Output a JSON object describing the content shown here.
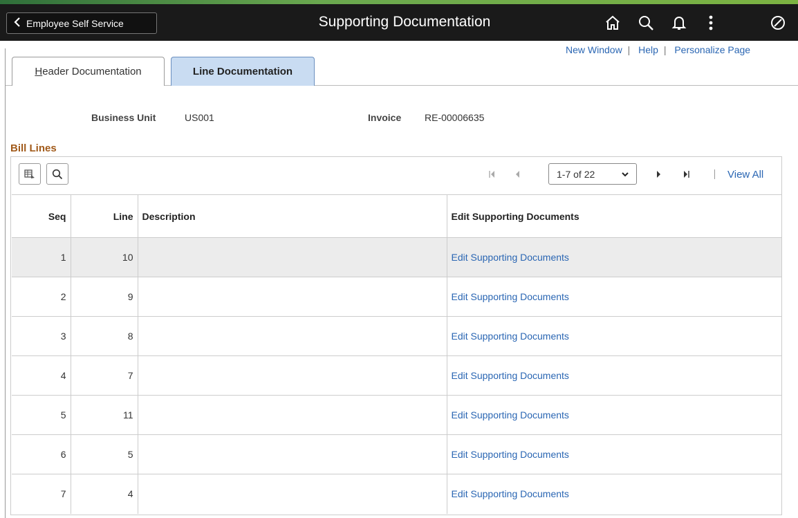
{
  "header": {
    "back_label": "Employee Self Service",
    "title": "Supporting Documentation",
    "icons": [
      "home-icon",
      "search-icon",
      "bell-icon",
      "kebab-menu-icon",
      "navbar-compass-icon"
    ]
  },
  "utility_links": {
    "new_window": "New Window",
    "help": "Help",
    "personalize": "Personalize Page",
    "separator": "|"
  },
  "tabs": {
    "header_first": "H",
    "header_rest": "eader Documentation",
    "line": "Line Documentation"
  },
  "fields": {
    "business_unit_label": "Business Unit",
    "business_unit_value": "US001",
    "invoice_label": "Invoice",
    "invoice_value": "RE-00006635"
  },
  "grid": {
    "title": "Bill Lines",
    "pager_range": "1-7 of 22",
    "view_all": "View All",
    "separator": "|",
    "columns": {
      "seq": "Seq",
      "line": "Line",
      "description": "Description",
      "edit": "Edit Supporting Documents"
    },
    "rows": [
      {
        "seq": "1",
        "line": "10",
        "description": "",
        "edit": "Edit Supporting Documents"
      },
      {
        "seq": "2",
        "line": "9",
        "description": "",
        "edit": "Edit Supporting Documents"
      },
      {
        "seq": "3",
        "line": "8",
        "description": "",
        "edit": "Edit Supporting Documents"
      },
      {
        "seq": "4",
        "line": "7",
        "description": "",
        "edit": "Edit Supporting Documents"
      },
      {
        "seq": "5",
        "line": "11",
        "description": "",
        "edit": "Edit Supporting Documents"
      },
      {
        "seq": "6",
        "line": "5",
        "description": "",
        "edit": "Edit Supporting Documents"
      },
      {
        "seq": "7",
        "line": "4",
        "description": "",
        "edit": "Edit Supporting Documents"
      }
    ]
  },
  "colors": {
    "header_bg": "#1a1a1a",
    "link": "#2a66b3",
    "active_tab": "#c9dcf2",
    "section_title": "#a15a1a"
  }
}
